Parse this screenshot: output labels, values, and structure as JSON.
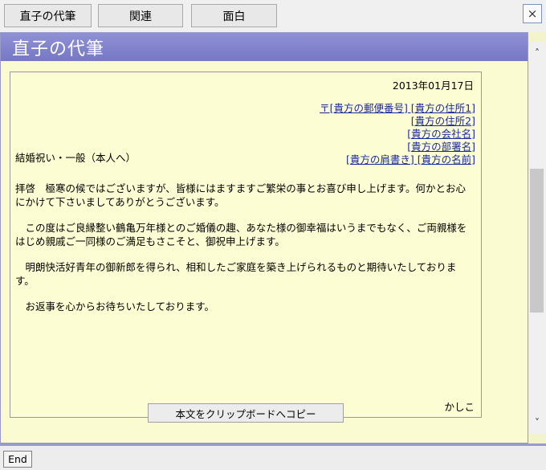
{
  "toolbar": {
    "tabs": [
      {
        "label": "直子の代筆"
      },
      {
        "label": "関連"
      },
      {
        "label": "面白"
      }
    ],
    "close_symbol": "×"
  },
  "window": {
    "title": "直子の代筆"
  },
  "letter": {
    "date": "2013年01月17日",
    "links": [
      "〒[貴方の郵便番号] [貴方の住所1]",
      "[貴方の住所2]",
      "[貴方の会社名]",
      "[貴方の部署名]",
      "[貴方の肩書き] [貴方の名前]"
    ],
    "subject": "結婚祝い・一般（本人へ）",
    "paragraphs": [
      "拝啓　極寒の候ではございますが、皆様にはますますご繁栄の事とお喜び申し上げます。何かとお心にかけて下さいましてありがとうございます。",
      "　この度はご良縁整い鶴亀万年様とのご婚儀の趣、あなた様の御幸福はいうまでもなく、ご両親様をはじめ親戚ご一同様のご満足もさこそと、御祝申上げます。",
      "　明朗快活好青年の御新郎を得られ、相和したご家庭を築き上げられるものと期待いたしております。",
      "　お返事を心からお待ちいたしております。"
    ],
    "closing": "かしこ"
  },
  "copy_button": {
    "label": "本文をクリップボードへコピー"
  },
  "footer": {
    "end_label": "End"
  }
}
